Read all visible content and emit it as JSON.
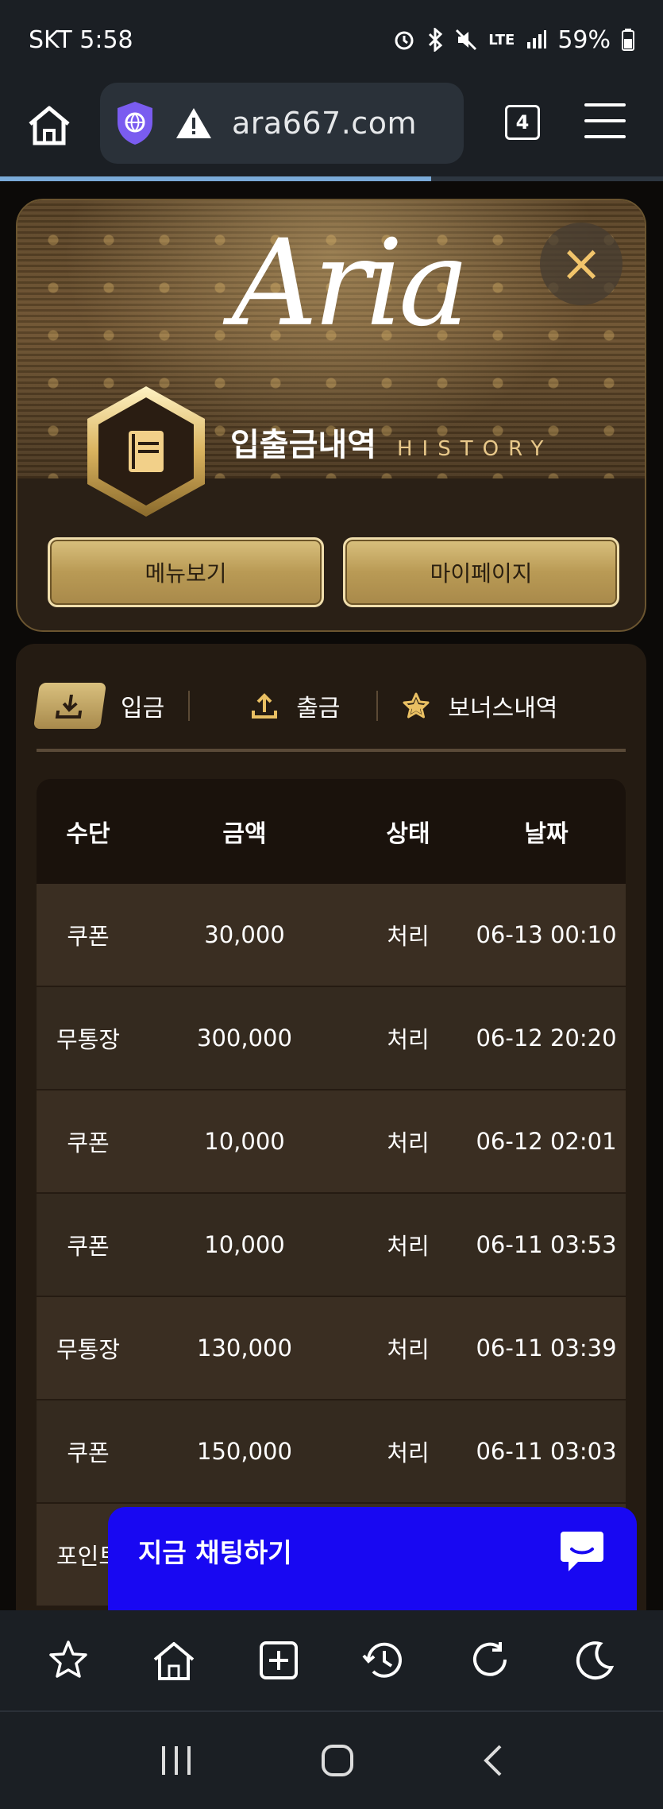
{
  "status_bar": {
    "carrier_time": "SKT 5:58",
    "network": "LTE",
    "battery": "59%"
  },
  "browser": {
    "url": "ara667.com",
    "tab_count": "4",
    "load_progress": 0.65
  },
  "header": {
    "logo_text": "Aria",
    "title_ko": "입출금내역",
    "title_en": "HISTORY",
    "close_label": "×",
    "buttons": {
      "menu": "메뉴보기",
      "mypage": "마이페이지"
    }
  },
  "tabs": [
    {
      "label": "입금",
      "icon": "download-icon",
      "active": true
    },
    {
      "label": "출금",
      "icon": "upload-icon",
      "active": false
    },
    {
      "label": "보너스내역",
      "icon": "star-icon",
      "active": false
    }
  ],
  "table": {
    "headers": [
      "수단",
      "금액",
      "상태",
      "날짜"
    ],
    "rows": [
      [
        "쿠폰",
        "30,000",
        "처리",
        "06-13 00:10"
      ],
      [
        "무통장",
        "300,000",
        "처리",
        "06-12 20:20"
      ],
      [
        "쿠폰",
        "10,000",
        "처리",
        "06-12 02:01"
      ],
      [
        "쿠폰",
        "10,000",
        "처리",
        "06-11 03:53"
      ],
      [
        "무통장",
        "130,000",
        "처리",
        "06-11 03:39"
      ],
      [
        "쿠폰",
        "150,000",
        "처리",
        "06-11 03:03"
      ],
      [
        "포인트",
        "",
        "",
        ""
      ]
    ]
  },
  "chat": {
    "label": "지금 채팅하기"
  },
  "colors": {
    "accent_gold": "#d9c07e",
    "chat_blue": "#1808f2",
    "browser_bg": "#1b1f24"
  }
}
